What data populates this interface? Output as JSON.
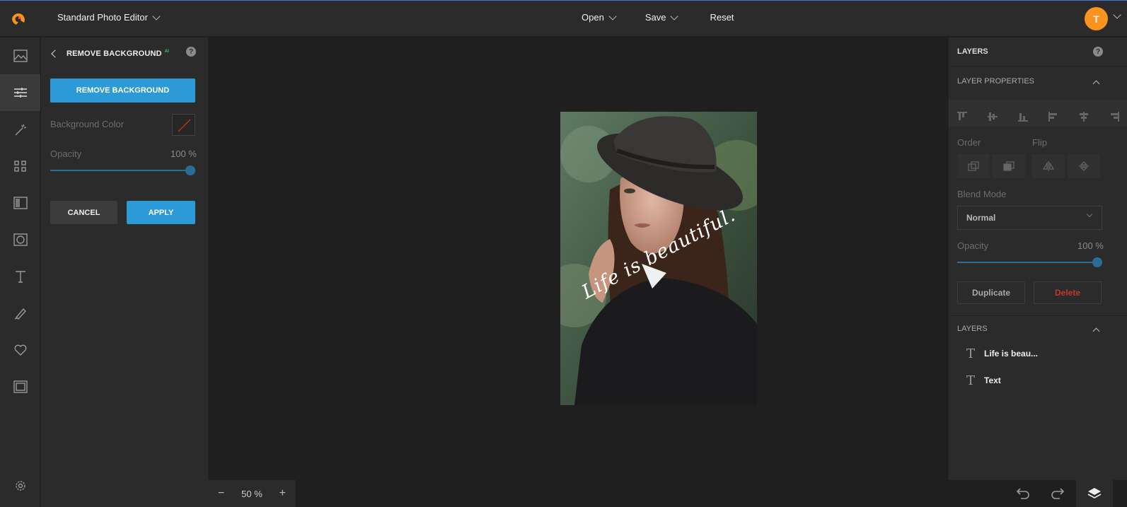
{
  "header": {
    "app_title": "Standard Photo Editor",
    "menu": [
      {
        "label": "Open"
      },
      {
        "label": "Save"
      },
      {
        "label": "Reset"
      }
    ],
    "avatar_initial": "T",
    "avatar_color": "#f7931e",
    "accent_color": "#2b9ad6"
  },
  "rail": {
    "icons": [
      "image-icon",
      "sliders-icon",
      "magic-wand-icon",
      "grid-icon",
      "frame-overlay-icon",
      "vignette-icon",
      "text-icon",
      "brush-icon",
      "heart-icon",
      "border-icon",
      "settings-icon"
    ],
    "active": "sliders-icon"
  },
  "tool_panel": {
    "title": "REMOVE BACKGROUND",
    "badge": "AI",
    "primary_button": "REMOVE BACKGROUND",
    "bg_color_label": "Background Color",
    "opacity_label": "Opacity",
    "opacity_value": "100 %",
    "opacity_level": 1.0,
    "cancel_label": "CANCEL",
    "apply_label": "APPLY"
  },
  "canvas": {
    "overlay_text": "Life is beautiful."
  },
  "bottom": {
    "zoom_minus": "−",
    "zoom_value": "50 %",
    "zoom_plus": "+"
  },
  "right_panel": {
    "title": "LAYERS",
    "layer_properties": "LAYER PROPERTIES",
    "order_label": "Order",
    "flip_label": "Flip",
    "blend_label": "Blend Mode",
    "blend_value": "Normal",
    "opacity_label": "Opacity",
    "opacity_value": "100 %",
    "opacity_level": 1.0,
    "duplicate_label": "Duplicate",
    "delete_label": "Delete",
    "delete_color": "#c0392b",
    "layers_section": "LAYERS",
    "layers": [
      {
        "name": "Life is beau..."
      },
      {
        "name": "Text"
      }
    ]
  }
}
